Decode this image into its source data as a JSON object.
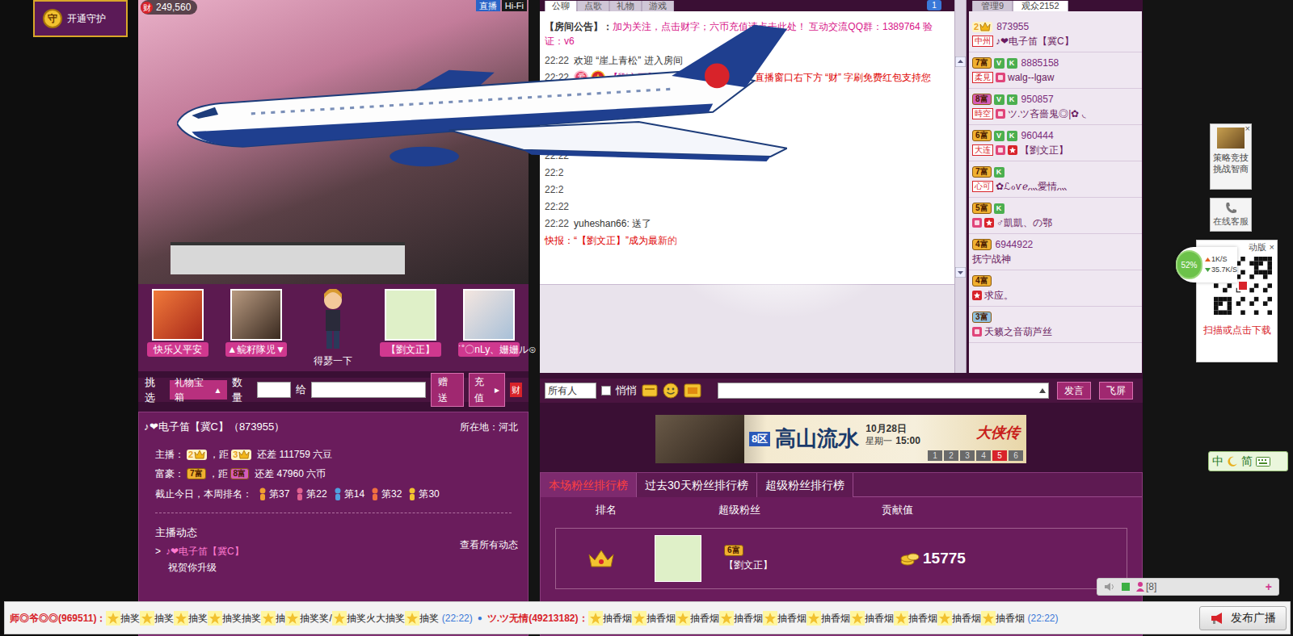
{
  "guard_button": {
    "icon": "守",
    "label": "开通守护"
  },
  "video": {
    "wealth_icon": "财",
    "wealth": "249,560",
    "tags": [
      "直播",
      "Hi-Fi"
    ]
  },
  "stage": [
    {
      "name": "快乐乂平安",
      "kind": "photo"
    },
    {
      "name": "▲鲩籽隊児▼",
      "kind": "photo"
    },
    {
      "name": "得瑟一下",
      "kind": "figure"
    },
    {
      "name": "【劉文正】",
      "kind": "photo"
    },
    {
      "name": "˙˚〇nLy、姗姗ル⊙",
      "kind": "photo"
    }
  ],
  "gift_bar": {
    "label": "挑选",
    "box": "礼物宝箱",
    "box_arrow": "▲",
    "qty": "数量",
    "to": "给",
    "send": "赠送",
    "recharge": "充值",
    "recharge_arrow": "▸",
    "wealth": "财"
  },
  "anchor": {
    "name": "♪❤电子笛【冀C】（873955）",
    "location": "所在地：河北",
    "progress": [
      {
        "label": "主播：",
        "from": "2",
        "from_kind": "crown",
        "from_color": "#e8a020",
        "sep": "，距",
        "to": "3",
        "to_kind": "crown",
        "to_color": "#e8a020",
        "gap": "还差 111759 六豆"
      },
      {
        "label": "富豪：",
        "from": "7富",
        "from_kind": "wealth",
        "from_color": "#f0b030",
        "sep": "，距",
        "to": "8富",
        "to_kind": "wealth",
        "to_color": "#d65cb8",
        "gap": "还差 47960 六币"
      }
    ],
    "ranks_label": "截止今日，本周排名：",
    "ranks": [
      "第37",
      "第22",
      "第14",
      "第32",
      "第30"
    ],
    "feed_title": "主播动态",
    "feed_more": "查看所有动态",
    "feed": [
      {
        "arrow": ">",
        "user": "♪❤电子笛【冀C】",
        "text": "祝贺你升级"
      }
    ]
  },
  "chat": {
    "tabs": [
      {
        "label": "公聊",
        "selected": true
      },
      {
        "label": "点歌",
        "selected": false
      },
      {
        "label": "礼物",
        "selected": false
      },
      {
        "label": "游戏",
        "selected": false
      }
    ],
    "unread": "1",
    "notice_label": "【房间公告】：",
    "notice": "加为关注，点击财字；六币充值请点击此处！ 互动交流QQ群：1389764 验证：v6",
    "messages": [
      {
        "kind": "text",
        "time": "22:22",
        "text": "欢迎 “崖上青松” 进入房间"
      },
      {
        "kind": "badged",
        "time": "22:22",
        "badge": "爱",
        "user": "【劉文正】",
        "text": "[96",
        "tail": "直播窗口右下方 “财” 字刷免费红包支持您"
      },
      {
        "kind": "time",
        "time": "22:22"
      },
      {
        "kind": "time",
        "time": "22:2"
      },
      {
        "kind": "time",
        "time": "22:2"
      },
      {
        "kind": "time",
        "time": "22:22"
      },
      {
        "kind": "text",
        "time": "22:22",
        "text": "yuheshan66: 送了"
      },
      {
        "kind": "report",
        "text": "快报：“【劉文正】”成为最新的"
      }
    ]
  },
  "audience": {
    "tabs": [
      {
        "label": "管理9",
        "selected": false
      },
      {
        "label": "观众2152",
        "selected": true
      }
    ],
    "items": [
      {
        "rich": "2",
        "rich_kind": "crown",
        "color": "#e8a020",
        "badges": [],
        "id": "873955",
        "tag": "中州",
        "shield": false,
        "star": false,
        "name": "♪❤电子笛【冀C】"
      },
      {
        "rich": "7富",
        "rich_kind": "wealth",
        "color": "#f0b030",
        "badges": [
          "V",
          "K"
        ],
        "id": "8885158",
        "tag": "柔見",
        "shield": true,
        "star": false,
        "name": "walg--lgaw"
      },
      {
        "rich": "8富",
        "rich_kind": "wealth",
        "color": "#d65cb8",
        "badges": [
          "V",
          "K"
        ],
        "id": "950857",
        "tag": "時空",
        "shield": true,
        "star": false,
        "name": "ツ.ツ吝嗇鬼◎|✿ ◟"
      },
      {
        "rich": "6富",
        "rich_kind": "wealth",
        "color": "#f0b030",
        "badges": [
          "V",
          "K"
        ],
        "id": "960444",
        "tag": "大连",
        "shield": true,
        "star": true,
        "name": "【劉文正】"
      },
      {
        "rich": "7富",
        "rich_kind": "wealth",
        "color": "#f0b030",
        "badges": [
          "K"
        ],
        "tag": "心可",
        "shield": false,
        "star": false,
        "name": "✿ℒℴѵℯ灬愛情灬"
      },
      {
        "rich": "5富",
        "rich_kind": "wealth",
        "color": "#f0b030",
        "badges": [
          "K"
        ],
        "shield": true,
        "star": true,
        "name": "♂凱凱、の鄂"
      },
      {
        "rich": "4富",
        "rich_kind": "wealth",
        "color": "#f0b030",
        "badges": [],
        "id": "6944922",
        "shield": false,
        "star": false,
        "name": "抚宁战神"
      },
      {
        "rich": "4富",
        "rich_kind": "wealth",
        "color": "#f0b030",
        "badges": [],
        "shield": false,
        "star": true,
        "name": "求应。"
      },
      {
        "rich": "3富",
        "rich_kind": "wealth",
        "color": "#8fc0e0",
        "badges": [],
        "shield": true,
        "star": false,
        "name": "天籁之音葫芦丝"
      }
    ]
  },
  "chat_input": {
    "target": "所有人",
    "whisper": {
      "label": "悄悄",
      "checked": false
    },
    "send": "发言",
    "fly": "飞屏"
  },
  "banner": {
    "server": "8区",
    "title": "高山流水",
    "date": "10月28日",
    "weekday": "星期一",
    "time": "15:00",
    "brand": "大侠传",
    "pages": [
      {
        "label": "1",
        "selected": false
      },
      {
        "label": "2",
        "selected": false
      },
      {
        "label": "3",
        "selected": false
      },
      {
        "label": "4",
        "selected": false
      },
      {
        "label": "5",
        "selected": true
      },
      {
        "label": "6",
        "selected": false
      }
    ]
  },
  "fans": {
    "tabs": [
      {
        "label": "本场粉丝排行榜",
        "selected": true
      },
      {
        "label": "过去30天粉丝排行榜",
        "selected": false
      },
      {
        "label": "超级粉丝排行榜",
        "selected": false
      }
    ],
    "columns": [
      "排名",
      "超级粉丝",
      "贡献值"
    ],
    "rows": [
      {
        "rich": "6富",
        "name": "【劉文正】",
        "value": "15775"
      }
    ]
  },
  "broadcast": {
    "messages": [
      {
        "user": "师◎爷◎◎(969511)：",
        "items": [
          "抽奖",
          "抽奖",
          "抽奖",
          "抽奖抽奖",
          "抽",
          "抽奖奖/",
          "抽奖火大抽奖",
          "抽奖"
        ],
        "time": "(22:22)"
      },
      {
        "user": "ツ.ツ无情(49213182)：",
        "items": [
          "抽香烟",
          "抽香烟",
          "抽香烟",
          "抽香烟",
          "抽香烟",
          "抽香烟",
          "抽香烟",
          "抽香烟",
          "抽香烟",
          "抽香烟"
        ],
        "time": "(22:22)"
      }
    ],
    "separator": "●",
    "button": "发布广播"
  },
  "mini_panel": {
    "count": "[8]",
    "plus": "+"
  },
  "side": {
    "ad": {
      "lines": [
        "策略竞技",
        "挑战智商"
      ],
      "close": "×"
    },
    "service": "在线客服",
    "qr": {
      "title": "动版",
      "close": "×",
      "percent": "52%",
      "up": "1K/S",
      "down": "35.7K/S",
      "link": "扫描或点击下载"
    },
    "ime": {
      "lang": "中",
      "mode": "简"
    }
  }
}
